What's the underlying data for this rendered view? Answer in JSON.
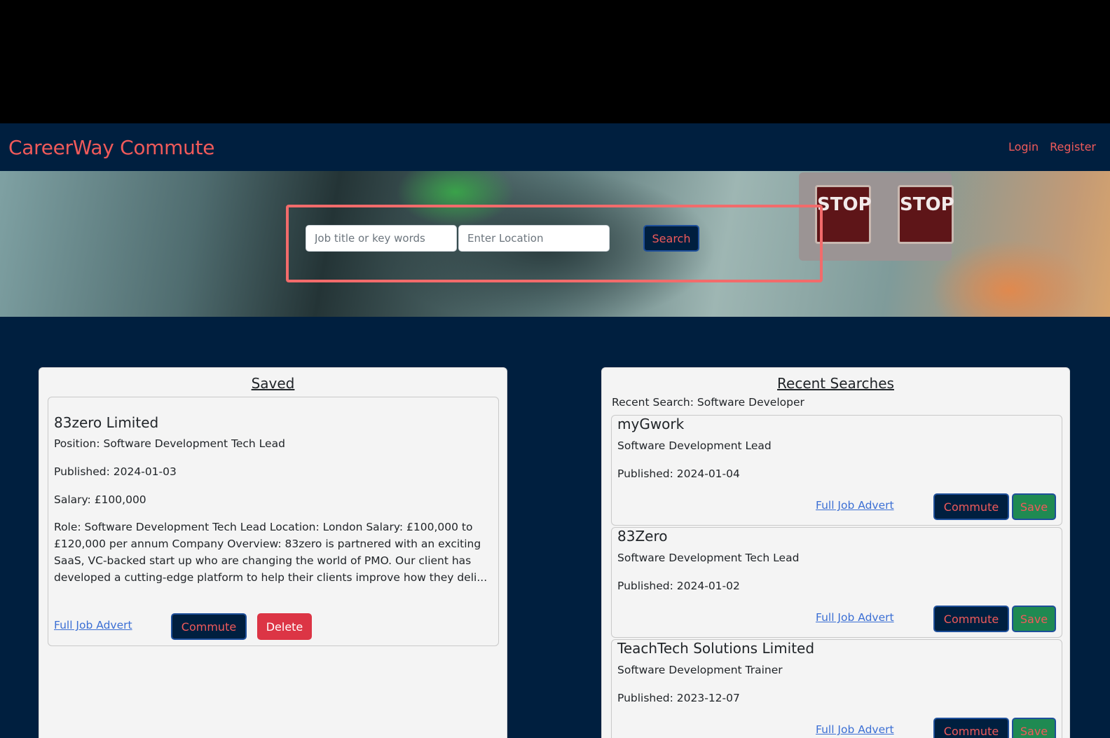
{
  "app": {
    "brand": "CareerWay Commute"
  },
  "nav": {
    "login": "Login",
    "register": "Register"
  },
  "hero": {
    "stop_text": "STOP",
    "search": {
      "job_placeholder": "Job title or key words",
      "location_placeholder": "Enter Location",
      "button": "Search"
    }
  },
  "saved": {
    "title": "Saved",
    "items": [
      {
        "company": "83zero Limited",
        "position": "Position: Software Development Tech Lead",
        "published": "Published: 2024-01-03",
        "salary": "Salary: £100,000",
        "description": "Role: Software Development Tech Lead Location: London Salary: £100,000 to £120,000 per annum Company Overview: 83zero is partnered with an exciting SaaS, VC-backed start up who are changing the world of PMO. Our client has developed a cutting-edge platform to help their clients improve how they deli...",
        "link": "Full Job Advert",
        "commute": "Commute",
        "delete": "Delete"
      }
    ]
  },
  "recent": {
    "title": "Recent Searches",
    "label": "Recent Search: Software Developer",
    "items": [
      {
        "company": "myGwork",
        "position": "Software Development Lead",
        "published": "Published: 2024-01-04",
        "link": "Full Job Advert",
        "commute": "Commute",
        "save": "Save"
      },
      {
        "company": "83Zero",
        "position": "Software Development Tech Lead",
        "published": "Published: 2024-01-02",
        "link": "Full Job Advert",
        "commute": "Commute",
        "save": "Save"
      },
      {
        "company": "TeachTech Solutions Limited",
        "position": "Software Development Trainer",
        "published": "Published: 2023-12-07",
        "link": "Full Job Advert",
        "commute": "Commute",
        "save": "Save"
      }
    ]
  },
  "colors": {
    "navy": "#001f3f",
    "accent": "#f05a5a",
    "panel": "#f4f4f4",
    "save_green": "#1f8a52",
    "delete_red": "#dc3545",
    "link_blue": "#3b6fd4"
  }
}
